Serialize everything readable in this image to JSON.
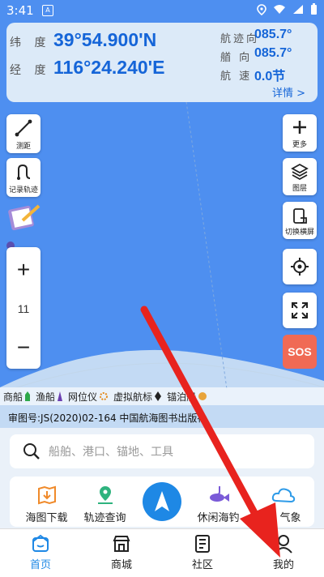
{
  "status": {
    "time": "3:41",
    "app_badge": "A"
  },
  "position": {
    "lat_label": "纬 度",
    "lat_value": "39°54.900'N",
    "lon_label": "经 度",
    "lon_value": "116°24.240'E",
    "track_label": "航迹向",
    "track_value": "085.7°",
    "heading_label": "艏 向",
    "heading_value": "085.7°",
    "speed_label": "航 速",
    "speed_value": "0.0节",
    "details_label": "详情 >"
  },
  "left_tools": {
    "measure": "测距",
    "record_track": "记录轨迹"
  },
  "right_tools": {
    "more": "更多",
    "layers": "图层",
    "landscape": "切换横屏"
  },
  "zoom": {
    "plus": "+",
    "level": "11",
    "minus": "−"
  },
  "sos_label": "SOS",
  "legend": [
    "商船",
    "渔船",
    "网位仪",
    "虚拟航标",
    "锚泊船"
  ],
  "approval_text": "审图号:JS(2020)02-164 中国航海图书出版社",
  "search": {
    "placeholder": "船舶、港口、锚地、工具"
  },
  "quick_actions": [
    "海图下载",
    "轨迹查询",
    "休闲海钓",
    "气象"
  ],
  "tabs": [
    "首页",
    "商城",
    "社区",
    "我的"
  ],
  "colors": {
    "accent": "#1565d8",
    "sos": "#f06a55",
    "map_sea": "#4e8ff0",
    "arrow": "#e8231e"
  }
}
